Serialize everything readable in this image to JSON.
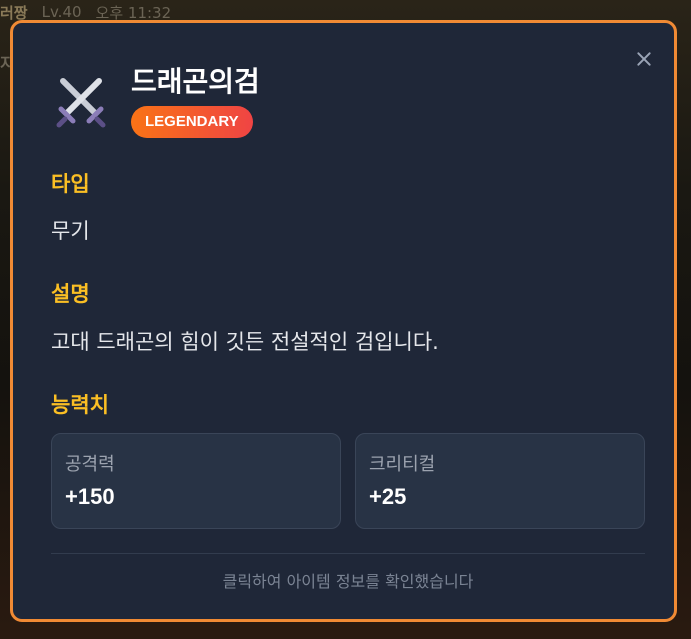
{
  "background": {
    "player_name": "러짱",
    "level": "Lv.40",
    "time": "오후 11:32",
    "side_text": "지"
  },
  "item": {
    "name": "드래곤의검",
    "rarity": "LEGENDARY",
    "icon": "crossed-swords-icon"
  },
  "sections": {
    "type_label": "타입",
    "type_value": "무기",
    "description_label": "설명",
    "description_value": "고대 드래곤의 힘이 깃든 전설적인 검입니다.",
    "stats_label": "능력치"
  },
  "stats": [
    {
      "label": "공격력",
      "value": "+150"
    },
    {
      "label": "크리티컬",
      "value": "+25"
    }
  ],
  "footer": "클릭하여 아이템 정보를 확인했습니다",
  "colors": {
    "accent_border": "#f08a34",
    "section_label": "#fbbf24",
    "badge_start": "#f97316",
    "badge_end": "#ef4444",
    "modal_bg": "#1f2738"
  }
}
